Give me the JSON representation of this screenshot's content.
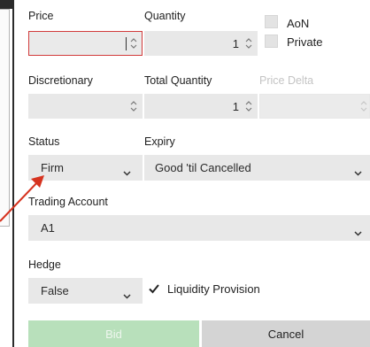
{
  "labels": {
    "price": "Price",
    "quantity": "Quantity",
    "discretionary": "Discretionary",
    "total_quantity": "Total Quantity",
    "price_delta": "Price Delta",
    "status": "Status",
    "expiry": "Expiry",
    "trading_account": "Trading Account",
    "hedge": "Hedge"
  },
  "fields": {
    "price": "",
    "quantity": "1",
    "discretionary": "",
    "total_quantity": "1",
    "price_delta": ""
  },
  "checkboxes": {
    "aon": {
      "label": "AoN",
      "checked": false
    },
    "private": {
      "label": "Private",
      "checked": false
    },
    "liquidity_provision": {
      "label": "Liquidity Provision",
      "checked": true
    }
  },
  "selects": {
    "status": "Firm",
    "expiry": "Good 'til Cancelled",
    "trading_account": "A1",
    "hedge": "False"
  },
  "buttons": {
    "bid": "Bid",
    "cancel": "Cancel"
  },
  "colors": {
    "focus_border": "#d13a3a",
    "annotation_arrow": "#d6331f",
    "bid_button": "#b8e0bb",
    "cancel_button": "#d4d4d4",
    "field_bg": "#e8e8e8"
  }
}
